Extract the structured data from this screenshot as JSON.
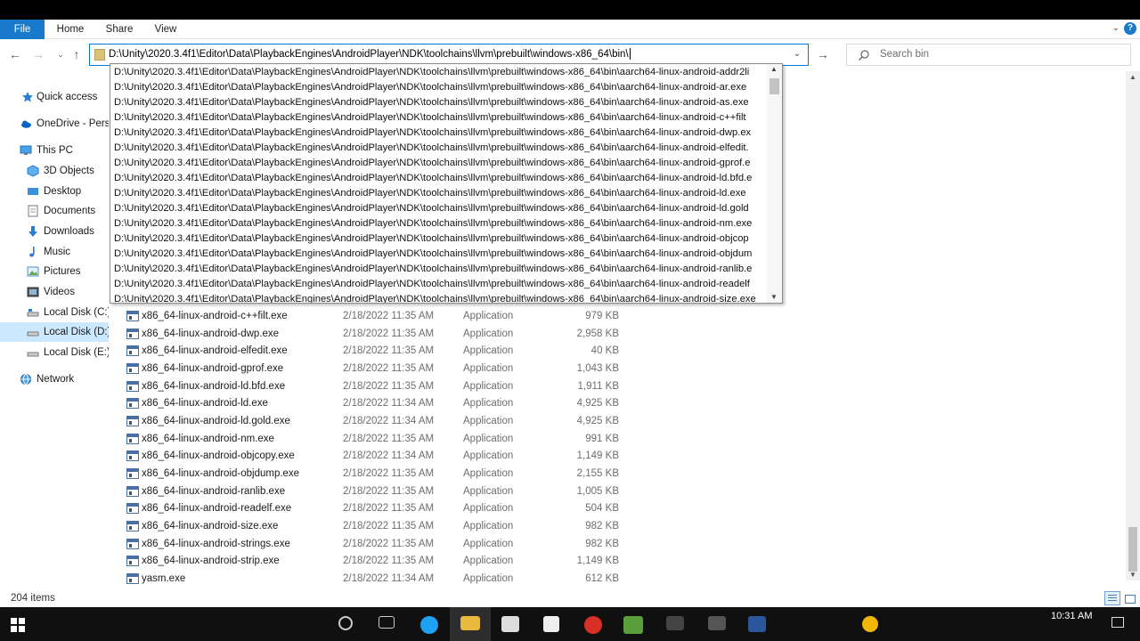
{
  "window": {
    "ribbon_tabs": {
      "file": "File",
      "home": "Home",
      "share": "Share",
      "view": "View"
    },
    "help": "?"
  },
  "address_bar": {
    "path": "D:\\Unity\\2020.3.4f1\\Editor\\Data\\PlaybackEngines\\AndroidPlayer\\NDK\\toolchains\\llvm\\prebuilt\\windows-x86_64\\bin\\"
  },
  "search": {
    "placeholder": "Search bin"
  },
  "sidebar": {
    "items": [
      {
        "label": "Quick access",
        "icon": "star-icon"
      },
      {
        "label": "OneDrive - Perso",
        "icon": "cloud-icon"
      },
      {
        "label": "This PC",
        "icon": "computer-icon"
      },
      {
        "label": "3D Objects",
        "icon": "cube-icon"
      },
      {
        "label": "Desktop",
        "icon": "desktop-icon"
      },
      {
        "label": "Documents",
        "icon": "document-icon"
      },
      {
        "label": "Downloads",
        "icon": "download-icon"
      },
      {
        "label": "Music",
        "icon": "music-icon"
      },
      {
        "label": "Pictures",
        "icon": "picture-icon"
      },
      {
        "label": "Videos",
        "icon": "video-icon"
      },
      {
        "label": "Local Disk (C:)",
        "icon": "drive-icon"
      },
      {
        "label": "Local Disk (D:)",
        "icon": "drive-icon"
      },
      {
        "label": "Local Disk (E:)",
        "icon": "drive-icon"
      },
      {
        "label": "Network",
        "icon": "network-icon"
      }
    ]
  },
  "autocomplete": {
    "items": [
      "D:\\Unity\\2020.3.4f1\\Editor\\Data\\PlaybackEngines\\AndroidPlayer\\NDK\\toolchains\\llvm\\prebuilt\\windows-x86_64\\bin\\aarch64-linux-android-addr2li",
      "D:\\Unity\\2020.3.4f1\\Editor\\Data\\PlaybackEngines\\AndroidPlayer\\NDK\\toolchains\\llvm\\prebuilt\\windows-x86_64\\bin\\aarch64-linux-android-ar.exe",
      "D:\\Unity\\2020.3.4f1\\Editor\\Data\\PlaybackEngines\\AndroidPlayer\\NDK\\toolchains\\llvm\\prebuilt\\windows-x86_64\\bin\\aarch64-linux-android-as.exe",
      "D:\\Unity\\2020.3.4f1\\Editor\\Data\\PlaybackEngines\\AndroidPlayer\\NDK\\toolchains\\llvm\\prebuilt\\windows-x86_64\\bin\\aarch64-linux-android-c++filt",
      "D:\\Unity\\2020.3.4f1\\Editor\\Data\\PlaybackEngines\\AndroidPlayer\\NDK\\toolchains\\llvm\\prebuilt\\windows-x86_64\\bin\\aarch64-linux-android-dwp.ex",
      "D:\\Unity\\2020.3.4f1\\Editor\\Data\\PlaybackEngines\\AndroidPlayer\\NDK\\toolchains\\llvm\\prebuilt\\windows-x86_64\\bin\\aarch64-linux-android-elfedit.",
      "D:\\Unity\\2020.3.4f1\\Editor\\Data\\PlaybackEngines\\AndroidPlayer\\NDK\\toolchains\\llvm\\prebuilt\\windows-x86_64\\bin\\aarch64-linux-android-gprof.e",
      "D:\\Unity\\2020.3.4f1\\Editor\\Data\\PlaybackEngines\\AndroidPlayer\\NDK\\toolchains\\llvm\\prebuilt\\windows-x86_64\\bin\\aarch64-linux-android-ld.bfd.e",
      "D:\\Unity\\2020.3.4f1\\Editor\\Data\\PlaybackEngines\\AndroidPlayer\\NDK\\toolchains\\llvm\\prebuilt\\windows-x86_64\\bin\\aarch64-linux-android-ld.exe",
      "D:\\Unity\\2020.3.4f1\\Editor\\Data\\PlaybackEngines\\AndroidPlayer\\NDK\\toolchains\\llvm\\prebuilt\\windows-x86_64\\bin\\aarch64-linux-android-ld.gold",
      "D:\\Unity\\2020.3.4f1\\Editor\\Data\\PlaybackEngines\\AndroidPlayer\\NDK\\toolchains\\llvm\\prebuilt\\windows-x86_64\\bin\\aarch64-linux-android-nm.exe",
      "D:\\Unity\\2020.3.4f1\\Editor\\Data\\PlaybackEngines\\AndroidPlayer\\NDK\\toolchains\\llvm\\prebuilt\\windows-x86_64\\bin\\aarch64-linux-android-objcop",
      "D:\\Unity\\2020.3.4f1\\Editor\\Data\\PlaybackEngines\\AndroidPlayer\\NDK\\toolchains\\llvm\\prebuilt\\windows-x86_64\\bin\\aarch64-linux-android-objdum",
      "D:\\Unity\\2020.3.4f1\\Editor\\Data\\PlaybackEngines\\AndroidPlayer\\NDK\\toolchains\\llvm\\prebuilt\\windows-x86_64\\bin\\aarch64-linux-android-ranlib.e",
      "D:\\Unity\\2020.3.4f1\\Editor\\Data\\PlaybackEngines\\AndroidPlayer\\NDK\\toolchains\\llvm\\prebuilt\\windows-x86_64\\bin\\aarch64-linux-android-readelf",
      "D:\\Unity\\2020.3.4f1\\Editor\\Data\\PlaybackEngines\\AndroidPlayer\\NDK\\toolchains\\llvm\\prebuilt\\windows-x86_64\\bin\\aarch64-linux-android-size.exe"
    ]
  },
  "files": [
    {
      "name": "x86_64-linux-android-c++filt.exe",
      "date": "2/18/2022 11:35 AM",
      "type": "Application",
      "size": "979 KB"
    },
    {
      "name": "x86_64-linux-android-dwp.exe",
      "date": "2/18/2022 11:35 AM",
      "type": "Application",
      "size": "2,958 KB"
    },
    {
      "name": "x86_64-linux-android-elfedit.exe",
      "date": "2/18/2022 11:35 AM",
      "type": "Application",
      "size": "40 KB"
    },
    {
      "name": "x86_64-linux-android-gprof.exe",
      "date": "2/18/2022 11:35 AM",
      "type": "Application",
      "size": "1,043 KB"
    },
    {
      "name": "x86_64-linux-android-ld.bfd.exe",
      "date": "2/18/2022 11:35 AM",
      "type": "Application",
      "size": "1,911 KB"
    },
    {
      "name": "x86_64-linux-android-ld.exe",
      "date": "2/18/2022 11:34 AM",
      "type": "Application",
      "size": "4,925 KB"
    },
    {
      "name": "x86_64-linux-android-ld.gold.exe",
      "date": "2/18/2022 11:34 AM",
      "type": "Application",
      "size": "4,925 KB"
    },
    {
      "name": "x86_64-linux-android-nm.exe",
      "date": "2/18/2022 11:35 AM",
      "type": "Application",
      "size": "991 KB"
    },
    {
      "name": "x86_64-linux-android-objcopy.exe",
      "date": "2/18/2022 11:34 AM",
      "type": "Application",
      "size": "1,149 KB"
    },
    {
      "name": "x86_64-linux-android-objdump.exe",
      "date": "2/18/2022 11:35 AM",
      "type": "Application",
      "size": "2,155 KB"
    },
    {
      "name": "x86_64-linux-android-ranlib.exe",
      "date": "2/18/2022 11:35 AM",
      "type": "Application",
      "size": "1,005 KB"
    },
    {
      "name": "x86_64-linux-android-readelf.exe",
      "date": "2/18/2022 11:35 AM",
      "type": "Application",
      "size": "504 KB"
    },
    {
      "name": "x86_64-linux-android-size.exe",
      "date": "2/18/2022 11:35 AM",
      "type": "Application",
      "size": "982 KB"
    },
    {
      "name": "x86_64-linux-android-strings.exe",
      "date": "2/18/2022 11:35 AM",
      "type": "Application",
      "size": "982 KB"
    },
    {
      "name": "x86_64-linux-android-strip.exe",
      "date": "2/18/2022 11:35 AM",
      "type": "Application",
      "size": "1,149 KB"
    },
    {
      "name": "yasm.exe",
      "date": "2/18/2022 11:34 AM",
      "type": "Application",
      "size": "612 KB"
    }
  ],
  "status": {
    "item_count": "204 items"
  },
  "taskbar": {
    "time": "10:31 AM"
  },
  "colors": {
    "accent": "#1979ca",
    "selection": "#cce8ff",
    "address_border": "#0078d7"
  }
}
